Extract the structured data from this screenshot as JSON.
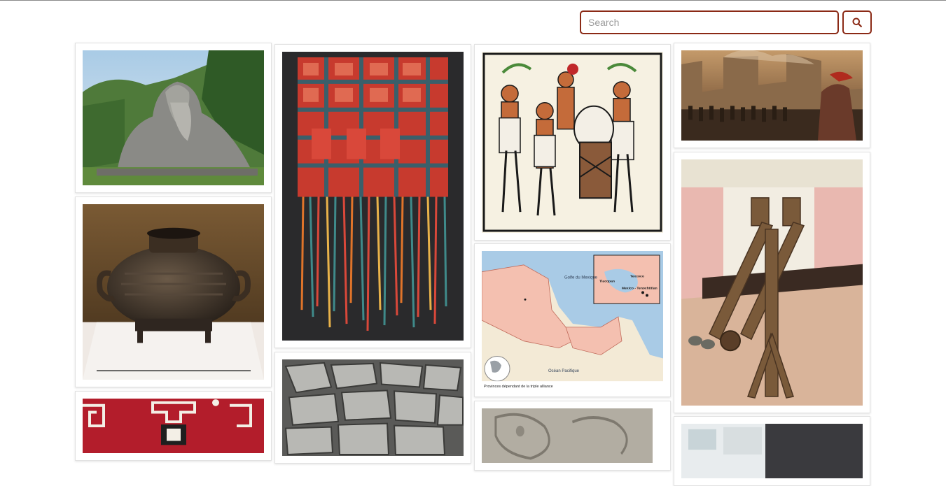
{
  "search": {
    "placeholder": "Search",
    "value": "",
    "button_icon": "search-icon"
  },
  "colors": {
    "accent": "#8b2a16"
  },
  "gallery": {
    "items": [
      {
        "subject": "laozi-statue"
      },
      {
        "subject": "bronze-vessel"
      },
      {
        "subject": "red-textile"
      },
      {
        "subject": "woven-panel-with-tassels"
      },
      {
        "subject": "stone-pavement"
      },
      {
        "subject": "aztec-codex-drummers"
      },
      {
        "subject": "triple-alliance-map"
      },
      {
        "subject": "carved-stone-relief"
      },
      {
        "subject": "roman-siege-painting"
      },
      {
        "subject": "wooden-ballista"
      },
      {
        "subject": "museum-model"
      }
    ]
  },
  "map_labels": {
    "gulf": "Golfe du Mexique",
    "ocean": "Océan Pacifique",
    "tlacopan": "Tlacopan",
    "texcoco": "Texcoco",
    "mexico": "Mexico - Tenochtitlan",
    "caption": "Provinces dépendant de la triple alliance"
  }
}
